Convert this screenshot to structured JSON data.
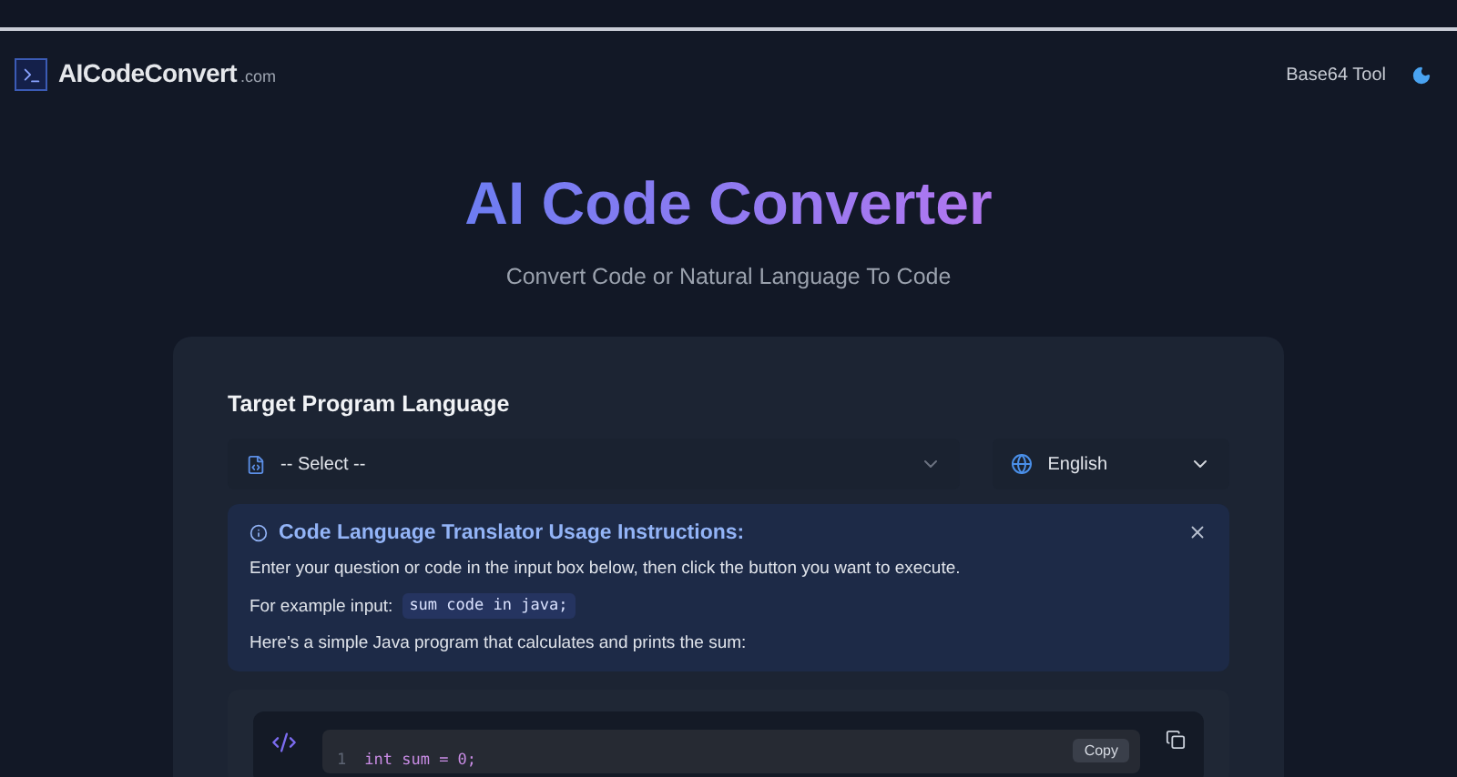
{
  "header": {
    "logo": "AICodeConvert",
    "logo_suffix": ".com",
    "nav": [
      "Base64 Tool"
    ]
  },
  "hero": {
    "title": "AI Code Converter",
    "subtitle": "Convert Code or Natural Language To Code"
  },
  "form": {
    "label": "Target Program Language",
    "language_select": {
      "value": "-- Select --"
    },
    "locale_select": {
      "value": "English"
    }
  },
  "notice": {
    "title": "Code Language Translator Usage Instructions:",
    "lines": [
      "Enter your question or code in the input box below, then click the button you want to execute."
    ],
    "example_label": "For example input:",
    "example_code": "sum code in java;",
    "footer": "Here's a simple Java program that calculates and prints the sum:"
  },
  "code_block": {
    "copy_label": "Copy",
    "lines": [
      {
        "number": "1",
        "code": "int sum = 0;"
      }
    ]
  }
}
